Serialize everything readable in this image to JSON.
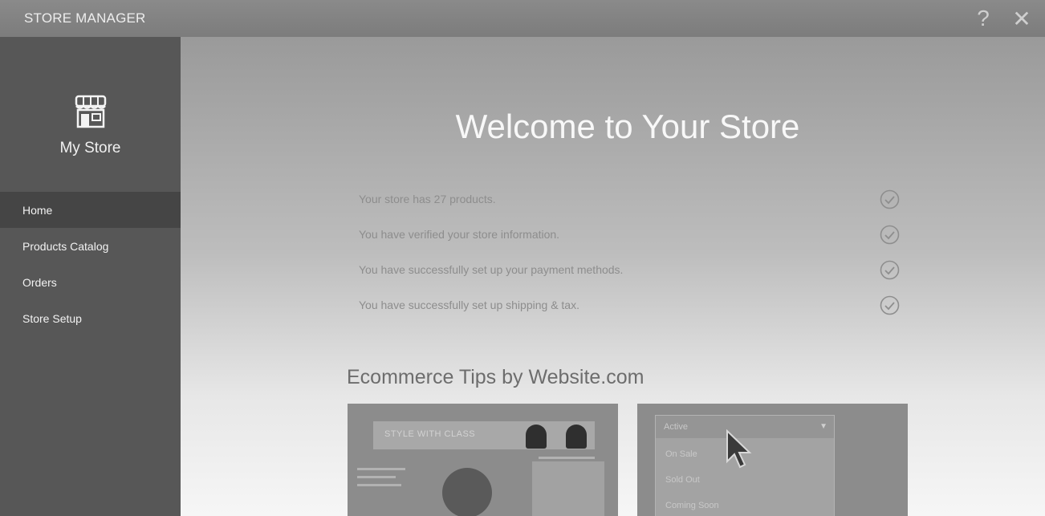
{
  "window": {
    "title": "STORE MANAGER",
    "help_glyph": "?",
    "close_glyph": "✕"
  },
  "sidebar": {
    "store_name": "My Store",
    "store_icon": "storefront-icon",
    "nav": [
      {
        "label": "Home",
        "active": true
      },
      {
        "label": "Products Catalog",
        "active": false
      },
      {
        "label": "Orders",
        "active": false
      },
      {
        "label": "Store Setup",
        "active": false
      }
    ]
  },
  "main": {
    "welcome": "Welcome to Your Store",
    "checklist": [
      {
        "text": "Your store has 27 products.",
        "icon": "check-circle-icon"
      },
      {
        "text": "You have verified your store information.",
        "icon": "check-circle-icon"
      },
      {
        "text": "You have successfully set up your payment methods.",
        "icon": "check-circle-icon"
      },
      {
        "text": "You have successfully set up shipping & tax.",
        "icon": "check-circle-icon"
      }
    ],
    "tips_heading": "Ecommerce Tips by Website.com",
    "tip_cards": [
      {
        "preview_banner": "STYLE WITH CLASS"
      },
      {
        "dropdown_selected": "Active",
        "dropdown_options": [
          "On Sale",
          "Sold Out",
          "Coming Soon"
        ]
      }
    ]
  },
  "colors": {
    "sidebar": "#575757",
    "active_nav": "#454545",
    "titlebar": "#828282"
  }
}
